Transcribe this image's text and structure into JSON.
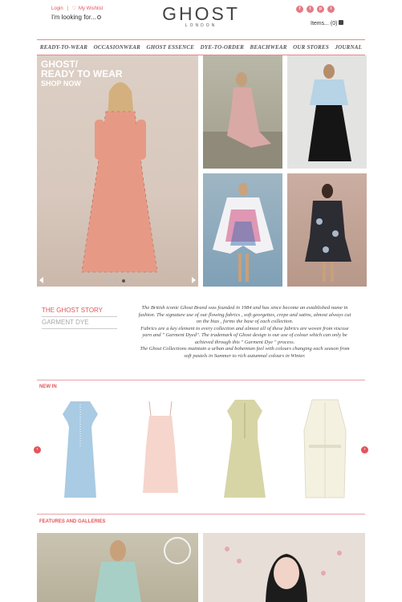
{
  "header": {
    "login": "Login",
    "separator": "|",
    "wishlist": "My Wishlist",
    "search_placeholder": "I'm looking for...",
    "logo": "GHOST",
    "logo_sub": "LONDON",
    "items_label": "Items... (0)",
    "social": [
      "f",
      "t",
      "p",
      "i"
    ]
  },
  "nav": [
    "READY-TO-WEAR",
    "OCCASIONWEAR",
    "GHOST ESSENCE",
    "DYE-TO-ORDER",
    "BEACHWEAR",
    "OUR STORES",
    "JOURNAL"
  ],
  "hero": {
    "line1": "GHOST/",
    "line2": "READY TO WEAR",
    "line3": "SHOP NOW"
  },
  "story": {
    "tab_active": "THE GHOST STORY",
    "tab_inactive": "GARMENT DYE",
    "paragraphs": [
      "The British iconic Ghost Brand was founded in 1984 and has since become an established name in fashion. The signature use of our flowing fabrics , soft georgettes, crepe and satins, almost always cut on the bias , forms the base of each collection.",
      "Fabrics are a key element to every collection and almost all of these fabrics are woven from viscose yarn and \" Garment Dyed\". The trademark of Ghost design is our use of colour which can only be achieved through this \" Garment Dye \" process.",
      "The Ghost Collections maintain a urban and bohemian feel with colours changing each season from soft pastels in Summer to rich autumnal colours in Winter."
    ]
  },
  "sections": {
    "new_in": "NEW IN",
    "features": "FEATURES AND GALLERIES"
  },
  "colors": {
    "accent": "#e0565b",
    "divider": "#e6a3a9"
  }
}
